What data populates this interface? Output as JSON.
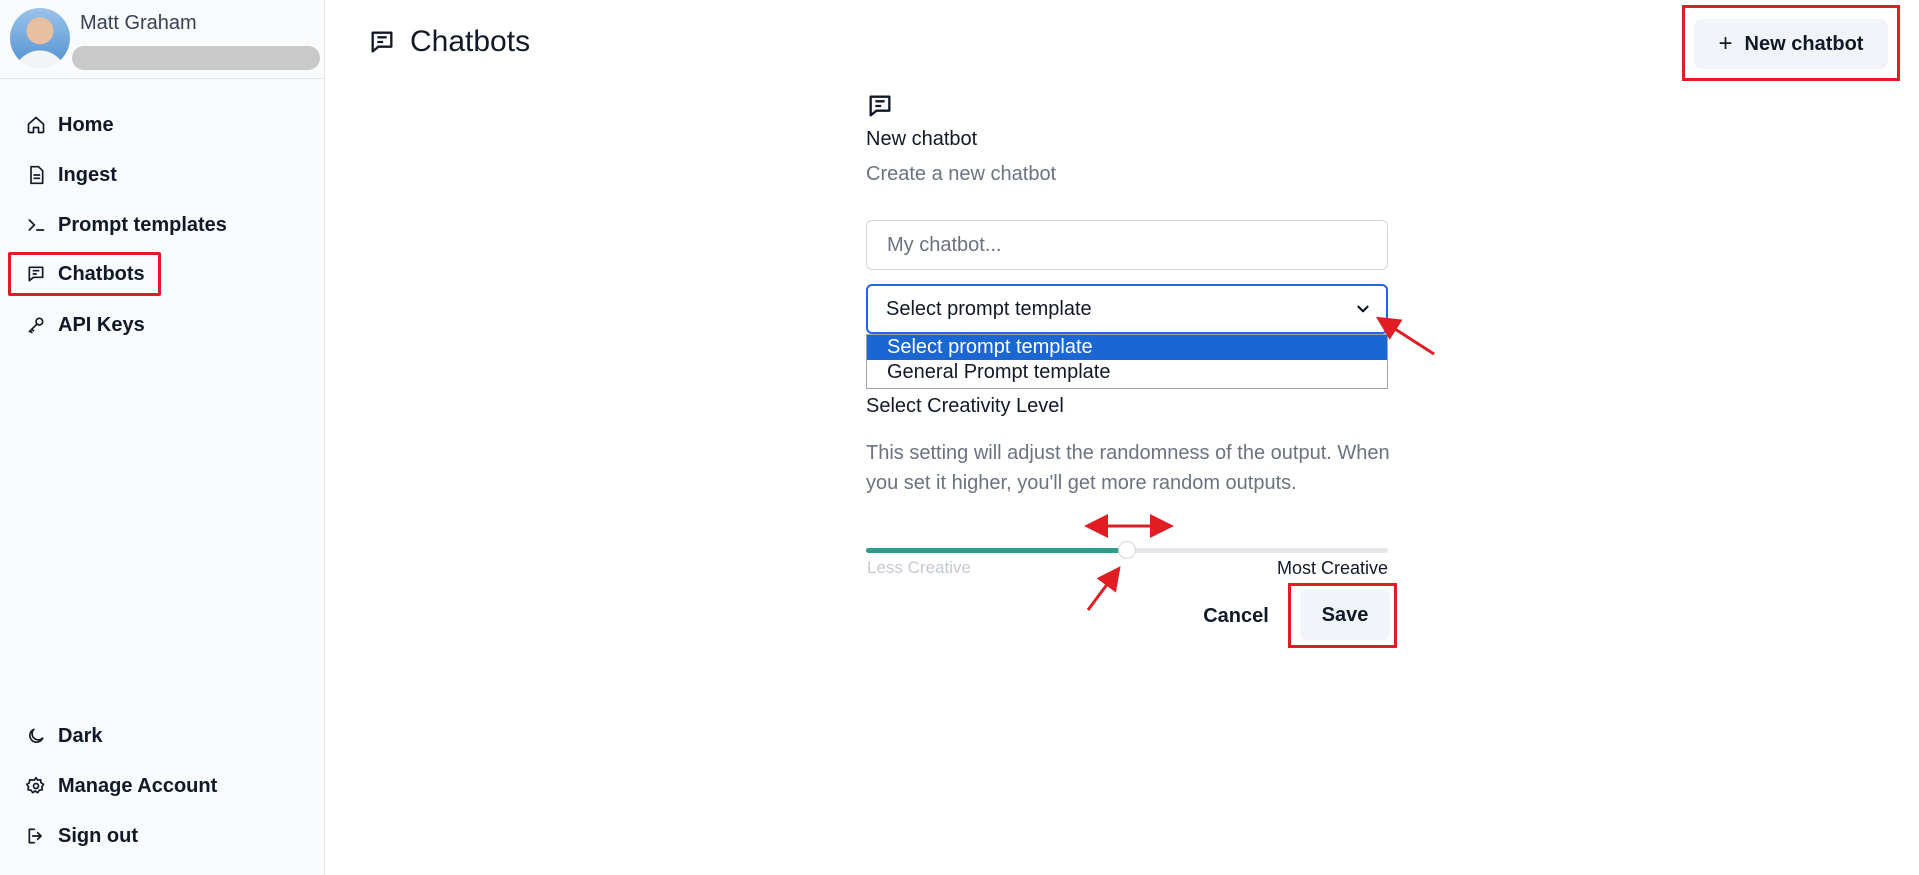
{
  "user": {
    "name": "Matt Graham"
  },
  "sidebar": {
    "items": [
      {
        "label": "Home",
        "icon": "home-icon"
      },
      {
        "label": "Ingest",
        "icon": "document-icon"
      },
      {
        "label": "Prompt templates",
        "icon": "terminal-icon"
      },
      {
        "label": "Chatbots",
        "icon": "chat-icon",
        "active": true
      },
      {
        "label": "API Keys",
        "icon": "key-icon"
      }
    ],
    "bottom_items": [
      {
        "label": "Dark",
        "icon": "moon-icon"
      },
      {
        "label": "Manage Account",
        "icon": "gear-icon"
      },
      {
        "label": "Sign out",
        "icon": "sign-out-icon"
      }
    ]
  },
  "header": {
    "title": "Chatbots",
    "new_button_label": "New chatbot"
  },
  "form": {
    "title": "New chatbot",
    "subtitle": "Create a new chatbot",
    "name_placeholder": "My chatbot...",
    "select_value": "Select prompt template",
    "select_options": [
      "Select prompt template",
      "General Prompt template"
    ],
    "creativity_label": "Select Creativity Level",
    "creativity_description": "This setting will adjust the randomness of the output. When you set it higher, you'll get more random outputs.",
    "slider_min_label": "Less Creative",
    "slider_max_label": "Most Creative",
    "slider_value": 0.5,
    "cancel_label": "Cancel",
    "save_label": "Save"
  },
  "colors": {
    "highlight": "#e11d24",
    "slider_fill": "#2c9c8c",
    "select_focus": "#2563eb",
    "option_selected": "#1a66d3"
  }
}
